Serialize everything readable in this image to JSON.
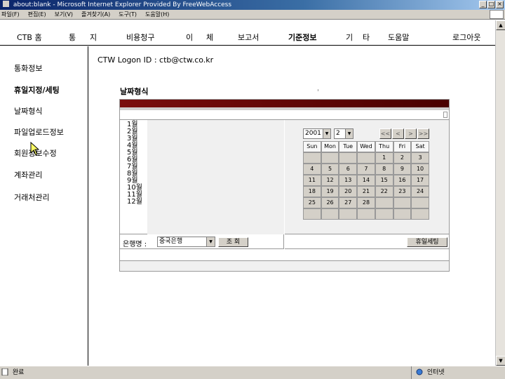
{
  "window": {
    "title": "about:blank - Microsoft Internet Explorer Provided By FreeWebAccess",
    "controls": [
      "_",
      "□",
      "×"
    ]
  },
  "menubar": {
    "items": [
      "파일(F)",
      "편집(E)",
      "보기(V)",
      "즐겨찾기(A)",
      "도구(T)",
      "도움말(H)"
    ]
  },
  "topnav": {
    "items": [
      {
        "label": "CTB 홈",
        "active": false
      },
      {
        "label": "통",
        "active": false
      },
      {
        "label": "지",
        "active": false
      },
      {
        "label": "비용청구",
        "active": false
      },
      {
        "label": "이",
        "active": false
      },
      {
        "label": "체",
        "active": false
      },
      {
        "label": "보고서",
        "active": false
      },
      {
        "label": "기준정보",
        "active": true
      },
      {
        "label": "기",
        "active": false
      },
      {
        "label": "타",
        "active": false
      },
      {
        "label": "도움말",
        "active": false
      },
      {
        "label": "로그아웃",
        "active": false
      }
    ]
  },
  "sidebar": {
    "items": [
      {
        "label": "통화정보",
        "bold": false
      },
      {
        "label": "휴일지정/세팅",
        "bold": true
      },
      {
        "label": "날짜형식",
        "bold": false
      },
      {
        "label": "파일업로드정보",
        "bold": false
      },
      {
        "label": "회원정보수정",
        "bold": false
      },
      {
        "label": "계좌관리",
        "bold": false
      },
      {
        "label": "거래처관리",
        "bold": false
      }
    ]
  },
  "logon": {
    "text": "CTW Logon ID : ctb@ctw.co.kr"
  },
  "section": {
    "title": "날짜형식"
  },
  "months": [
    "1월",
    "2월",
    "3월",
    "4월",
    "5월",
    "6월",
    "7월",
    "8월",
    "9월",
    "10월",
    "11월",
    "12월"
  ],
  "calendar": {
    "year": "2001",
    "month": "2",
    "nav": [
      "<<",
      "<",
      ">",
      ">>"
    ],
    "weekdays": [
      "Sun",
      "Mon",
      "Tue",
      "Wed",
      "Thu",
      "Fri",
      "Sat"
    ],
    "weeks": [
      [
        "",
        "",
        "",
        "",
        "1",
        "2",
        "3"
      ],
      [
        "4",
        "5",
        "6",
        "7",
        "8",
        "9",
        "10"
      ],
      [
        "11",
        "12",
        "13",
        "14",
        "15",
        "16",
        "17"
      ],
      [
        "18",
        "19",
        "20",
        "21",
        "22",
        "23",
        "24"
      ],
      [
        "25",
        "26",
        "27",
        "28",
        "",
        "",
        ""
      ],
      [
        "",
        "",
        "",
        "",
        "",
        "",
        ""
      ]
    ]
  },
  "bank": {
    "label": "은행명 :",
    "selected": "중국은행",
    "query_button": "조 회"
  },
  "holiday": {
    "button": "휴일세팅"
  },
  "status": {
    "left": "완료",
    "right": "인터넷"
  },
  "colors": {
    "panel_bar": "#7a0d0d",
    "titlebar": "#0a246a",
    "chrome": "#d4d0c8"
  }
}
